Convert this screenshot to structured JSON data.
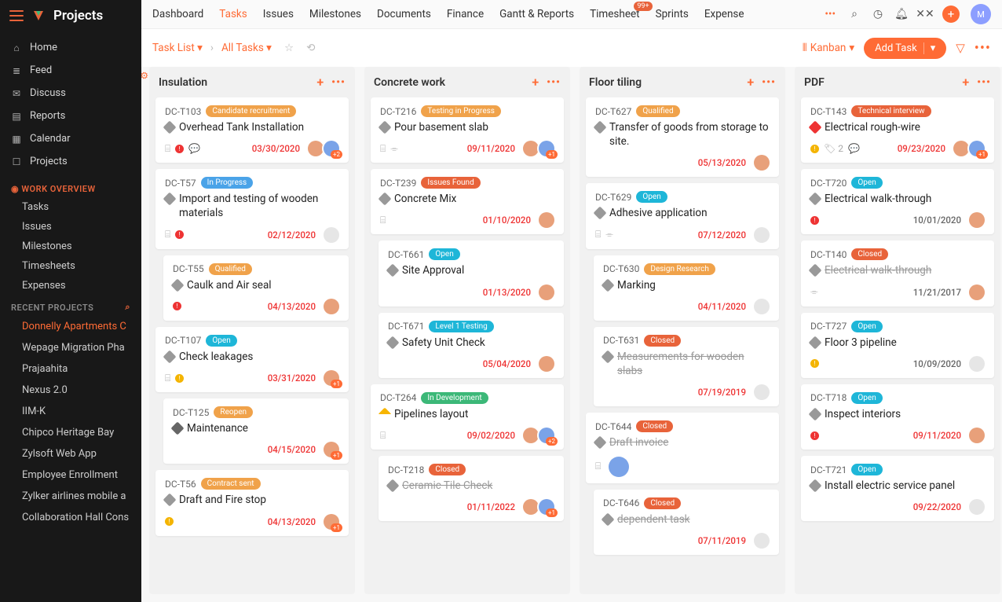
{
  "brand": "Projects",
  "sidebarNav": [
    {
      "icon": "⌂",
      "label": "Home"
    },
    {
      "icon": "≣",
      "label": "Feed"
    },
    {
      "icon": "✉",
      "label": "Discuss"
    },
    {
      "icon": "▤",
      "label": "Reports"
    },
    {
      "icon": "▦",
      "label": "Calendar"
    },
    {
      "icon": "☐",
      "label": "Projects"
    }
  ],
  "workOverview": {
    "title": "WORK OVERVIEW",
    "items": [
      "Tasks",
      "Issues",
      "Milestones",
      "Timesheets",
      "Expenses"
    ]
  },
  "recentProjects": {
    "title": "RECENT PROJECTS",
    "items": [
      {
        "label": "Donnelly Apartments C",
        "active": true
      },
      {
        "label": "Wepage Migration Pha",
        "active": false
      },
      {
        "label": "Prajaahita",
        "active": false
      },
      {
        "label": "Nexus 2.0",
        "active": false
      },
      {
        "label": "IIM-K",
        "active": false
      },
      {
        "label": "Chipco Heritage Bay",
        "active": false
      },
      {
        "label": "Zylsoft Web App",
        "active": false
      },
      {
        "label": "Employee Enrollment",
        "active": false
      },
      {
        "label": "Zylker airlines mobile a",
        "active": false
      },
      {
        "label": "Collaboration Hall Cons",
        "active": false
      }
    ]
  },
  "topnav": [
    {
      "label": "Dashboard"
    },
    {
      "label": "Tasks",
      "active": true
    },
    {
      "label": "Issues"
    },
    {
      "label": "Milestones"
    },
    {
      "label": "Documents"
    },
    {
      "label": "Finance"
    },
    {
      "label": "Gantt & Reports"
    },
    {
      "label": "Timesheet",
      "badge": "99+"
    },
    {
      "label": "Sprints"
    },
    {
      "label": "Expense"
    }
  ],
  "subbar": {
    "left1": "Task List",
    "left2": "All Tasks",
    "view": "Kanban",
    "addTask": "Add Task"
  },
  "statusColors": {
    "Candidate recruitment": "#f0a24a",
    "In Progress": "#4aa3e8",
    "Qualified": "#f0a24a",
    "Open": "#1eb6d8",
    "Reopen": "#f0a24a",
    "Contract sent": "#f0a24a",
    "Testing in Progress": "#f0a24a",
    "Issues Found": "#e8633a",
    "Level 1 Testing": "#1eb6d8",
    "In Development": "#3cb878",
    "Closed": "#e8633a",
    "Design Research": "#f0a24a",
    "Technical interview": "#e8633a"
  },
  "columns": [
    {
      "title": "Insulation",
      "cards": [
        {
          "id": "DC-T103",
          "status": "Candidate recruitment",
          "title": "Overhead Tank Installation",
          "date": "03/30/2020",
          "prio": "none",
          "icons": [
            "sub",
            "bang-red",
            "chat"
          ],
          "avatars": 2,
          "stackBadge": "+2"
        },
        {
          "id": "DC-T57",
          "status": "In Progress",
          "title": "Import and testing of wooden materials",
          "date": "02/12/2020",
          "prio": "none",
          "icons": [
            "sub",
            "bang-red"
          ],
          "avatars": 1,
          "empty": true
        },
        {
          "id": "DC-T55",
          "status": "Qualified",
          "title": "Caulk and Air seal",
          "date": "04/13/2020",
          "prio": "none",
          "icons": [
            "bang-red"
          ],
          "avatars": 1,
          "nested": true
        },
        {
          "id": "DC-T107",
          "status": "Open",
          "title": "Check leakages",
          "date": "03/31/2020",
          "prio": "none",
          "icons": [
            "sub",
            "bang-yellow"
          ],
          "avatars": 1,
          "stackBadge": "+1"
        },
        {
          "id": "DC-T125",
          "status": "Reopen",
          "title": "Maintenance",
          "date": "04/15/2020",
          "prio": "low",
          "icons": [],
          "avatars": 1,
          "stackBadge": "+1",
          "nested": true
        },
        {
          "id": "DC-T56",
          "status": "Contract sent",
          "title": "Draft and Fire stop",
          "date": "04/13/2020",
          "prio": "none",
          "icons": [
            "bang-yellow"
          ],
          "avatars": 1,
          "stackBadge": "+1"
        }
      ]
    },
    {
      "title": "Concrete work",
      "cards": [
        {
          "id": "DC-T216",
          "status": "Testing in Progress",
          "title": "Pour basement slab",
          "date": "09/11/2020",
          "prio": "none",
          "icons": [
            "sub",
            "bug"
          ],
          "avatars": 2,
          "stackBadge": "+1"
        },
        {
          "id": "DC-T239",
          "status": "Issues Found",
          "title": "Concrete Mix",
          "date": "01/10/2020",
          "prio": "none",
          "icons": [
            "sub"
          ],
          "avatars": 1
        },
        {
          "id": "DC-T661",
          "status": "Open",
          "title": "Site Approval",
          "date": "01/13/2020",
          "prio": "none",
          "icons": [],
          "avatars": 1,
          "nested": true
        },
        {
          "id": "DC-T671",
          "status": "Level 1 Testing",
          "title": "Safety Unit Check",
          "date": "05/04/2020",
          "prio": "none",
          "icons": [],
          "avatars": 1,
          "nested": true
        },
        {
          "id": "DC-T264",
          "status": "In Development",
          "title": "Pipelines layout",
          "date": "09/02/2020",
          "prio": "med",
          "icons": [
            "sub"
          ],
          "avatars": 2,
          "stackBadge": "+2"
        },
        {
          "id": "DC-T218",
          "status": "Closed",
          "title": "Ceramic Tile Check",
          "date": "01/11/2022",
          "prio": "none",
          "icons": [],
          "avatars": 2,
          "stackBadge": "+1",
          "closed": true,
          "nested": true
        }
      ]
    },
    {
      "title": "Floor tiling",
      "cards": [
        {
          "id": "DC-T627",
          "status": "Qualified",
          "title": "Transfer of goods from storage to site.",
          "date": "05/13/2020",
          "prio": "none",
          "icons": [],
          "avatars": 1
        },
        {
          "id": "DC-T629",
          "status": "Open",
          "title": "Adhesive application",
          "date": "07/12/2020",
          "prio": "none",
          "icons": [
            "sub",
            "bug"
          ],
          "avatars": 1,
          "empty": true
        },
        {
          "id": "DC-T630",
          "status": "Design Research",
          "title": "Marking",
          "date": "04/11/2020",
          "prio": "none",
          "icons": [],
          "avatars": 1,
          "empty": true,
          "nested": true
        },
        {
          "id": "DC-T631",
          "status": "Closed",
          "title": "Measurements for wooden slabs",
          "date": "07/19/2019",
          "prio": "none",
          "icons": [],
          "avatars": 1,
          "empty": true,
          "closed": true,
          "nested": true
        },
        {
          "id": "DC-T644",
          "status": "Closed",
          "title": "Draft invoice",
          "date": "",
          "prio": "none",
          "icons": [
            "sub"
          ],
          "avatars": 1,
          "closed": true,
          "bigav": true
        },
        {
          "id": "DC-T646",
          "status": "Closed",
          "title": "dependent task",
          "date": "07/11/2019",
          "prio": "none",
          "icons": [],
          "avatars": 1,
          "empty": true,
          "closed": true,
          "nested": true
        }
      ]
    },
    {
      "title": "PDF",
      "cards": [
        {
          "id": "DC-T143",
          "status": "Technical interview",
          "title": "Electrical rough-wire",
          "date": "09/23/2020",
          "prio": "high",
          "icons": [
            "bang-yellow",
            "tag2",
            "chat"
          ],
          "avatars": 2,
          "stackBadge": "+1"
        },
        {
          "id": "DC-T720",
          "status": "Open",
          "title": "Electrical walk-through",
          "date": "10/01/2020",
          "prio": "none",
          "icons": [
            "bang-red"
          ],
          "avatars": 1,
          "muted": true
        },
        {
          "id": "DC-T140",
          "status": "Closed",
          "title": "Electrical walk-through",
          "date": "11/21/2017",
          "prio": "none",
          "icons": [
            "bug"
          ],
          "avatars": 1,
          "closed": true,
          "muted": true
        },
        {
          "id": "DC-T727",
          "status": "Open",
          "title": "Floor 3 pipeline",
          "date": "10/09/2020",
          "prio": "none",
          "icons": [
            "bang-yellow"
          ],
          "avatars": 1,
          "empty": true,
          "muted": true
        },
        {
          "id": "DC-T718",
          "status": "Open",
          "title": "Inspect interiors",
          "date": "09/11/2020",
          "prio": "none",
          "icons": [
            "bang-red"
          ],
          "avatars": 1
        },
        {
          "id": "DC-T721",
          "status": "Open",
          "title": "Install electric service panel",
          "date": "09/22/2020",
          "prio": "none",
          "icons": [],
          "avatars": 1,
          "empty": true
        }
      ]
    }
  ]
}
